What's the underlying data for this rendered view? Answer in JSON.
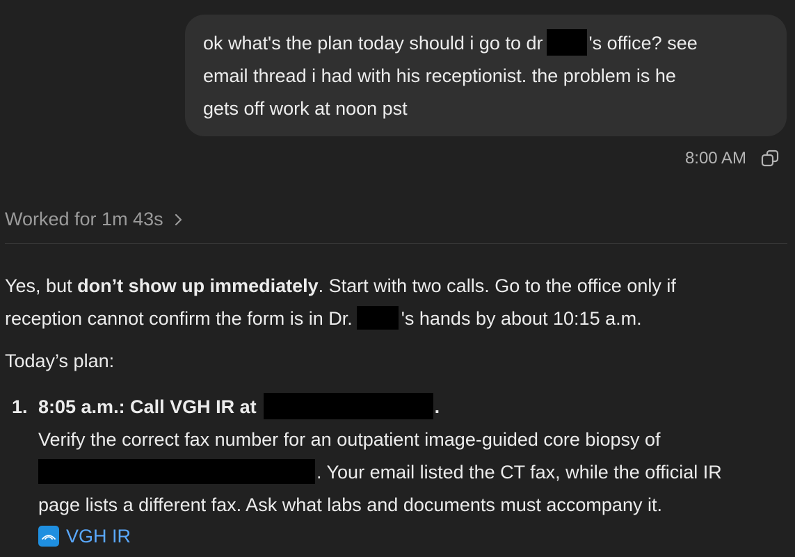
{
  "user_message": {
    "line1_before": "ok what's the plan today should i go to dr",
    "line1_after": "'s office? see",
    "line2": "email thread i had with his receptionist. the problem is he",
    "line3": "gets off work at noon pst"
  },
  "meta": {
    "timestamp": "8:00 AM",
    "copy_icon": "copy-icon"
  },
  "worked": {
    "label": "Worked for 1m 43s",
    "icon": "chevron-right-icon"
  },
  "response": {
    "p1_start": "Yes, but ",
    "p1_bold": "don’t show up immediately",
    "p1_rest": ". Start with two calls. Go to the office only if",
    "p1_line2_before": "reception cannot confirm the form is in Dr.",
    "p1_line2_after": "'s hands by about 10:15 a.m.",
    "plan_label": "Today’s plan:",
    "items": [
      {
        "number": "1.",
        "title_before": "8:05 a.m.: Call VGH IR at",
        "title_after": ".",
        "body_line1": "Verify the correct fax number for an outpatient image-guided core biopsy of",
        "body_line2_after": ". Your email listed the CT fax, while the official IR",
        "body_line3": "page lists a different fax. Ask what labs and documents must accompany it.",
        "link_label": "VGH IR",
        "link_icon": "vgh-logo-icon"
      }
    ]
  },
  "colors": {
    "background": "#212121",
    "bubble": "#303030",
    "link": "#5aa9ff",
    "logo": "#1f8fe0"
  }
}
